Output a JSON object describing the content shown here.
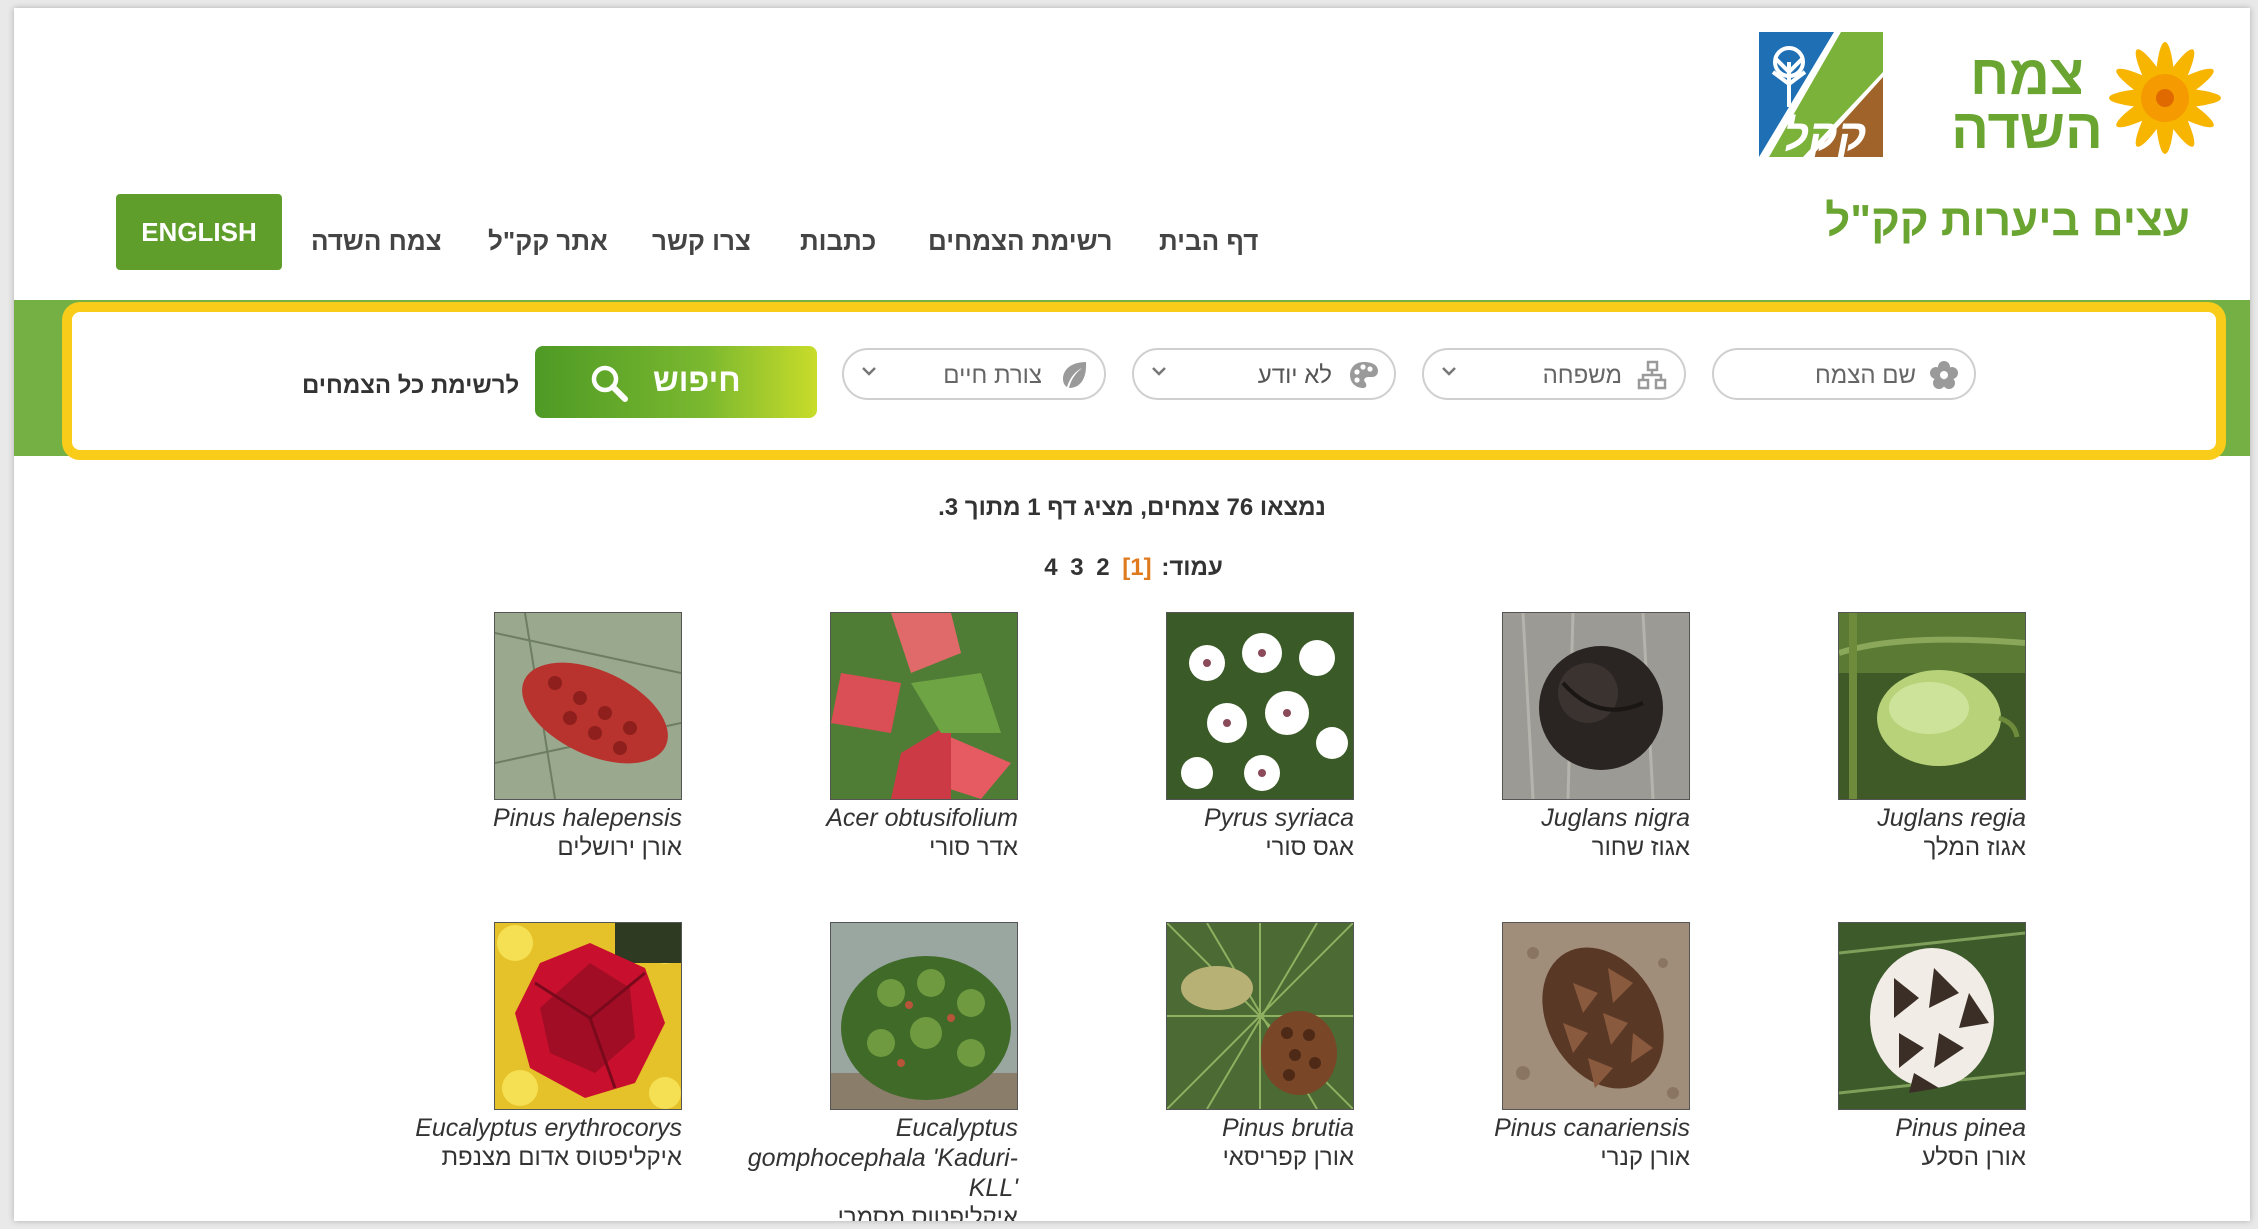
{
  "header": {
    "site_title": "עצים ביערות קק\"ל",
    "logo_tzemah_line1": "צמח",
    "logo_tzemah_line2": "השדה",
    "logo_kkl_text": "קקל",
    "nav": [
      {
        "label": "דף הבית"
      },
      {
        "label": "רשימת הצמחים"
      },
      {
        "label": "כתבות"
      },
      {
        "label": "צרו קשר"
      },
      {
        "label": "אתר קק\"ל"
      },
      {
        "label": "צמח השדה"
      }
    ],
    "english_label": "ENGLISH"
  },
  "search": {
    "plant_name_placeholder": "שם הצמח",
    "family_placeholder": "משפחה",
    "color_value": "לא יודע",
    "life_form_placeholder": "צורת חיים",
    "search_button_label": "חיפוש",
    "all_plants_link": "לרשימת כל הצמחים"
  },
  "results": {
    "summary": "נמצאו 76 צמחים, מציג דף 1 מתוך 3.",
    "page_label": "עמוד:",
    "current_page": "[1]",
    "other_pages": [
      "2",
      "3",
      "4"
    ]
  },
  "plants": [
    {
      "scientific": "Juglans regia",
      "hebrew": "אגוז המלך",
      "photo": "green walnut fruit"
    },
    {
      "scientific": "Juglans nigra",
      "hebrew": "אגוז שחור",
      "photo": "black walnut"
    },
    {
      "scientific": "Pyrus syriaca",
      "hebrew": "אגס סורי",
      "photo": "white pear blossoms"
    },
    {
      "scientific": "Acer obtusifolium",
      "hebrew": "אדר סורי",
      "photo": "red maple samaras"
    },
    {
      "scientific": "Pinus halepensis",
      "hebrew": "אורן ירושלים",
      "photo": "red pine cone"
    },
    {
      "scientific": "Pinus pinea",
      "hebrew": "אורן הסלע",
      "photo": "stone pine cone"
    },
    {
      "scientific": "Pinus canariensis",
      "hebrew": "אורן קנרי",
      "photo": "brown pine cone"
    },
    {
      "scientific": "Pinus brutia",
      "hebrew": "אורן קפריסאי",
      "photo": "pine cones on branch"
    },
    {
      "scientific": "Eucalyptus gomphocephala 'Kaduri-KLL'",
      "hebrew": "איקליפטוס מסמרי 'כדורי-קק\"ל'",
      "photo": "green shrub"
    },
    {
      "scientific": "Eucalyptus erythrocorys",
      "hebrew": "איקליפטוס אדום מצנפת",
      "photo": "red eucalyptus flower"
    }
  ],
  "colors": {
    "brand_green": "#6aa532",
    "nav_button_green": "#5f9e2b",
    "band_green": "#74b043",
    "frame_yellow": "#f9cc1a",
    "current_page_orange": "#e07a1f"
  }
}
